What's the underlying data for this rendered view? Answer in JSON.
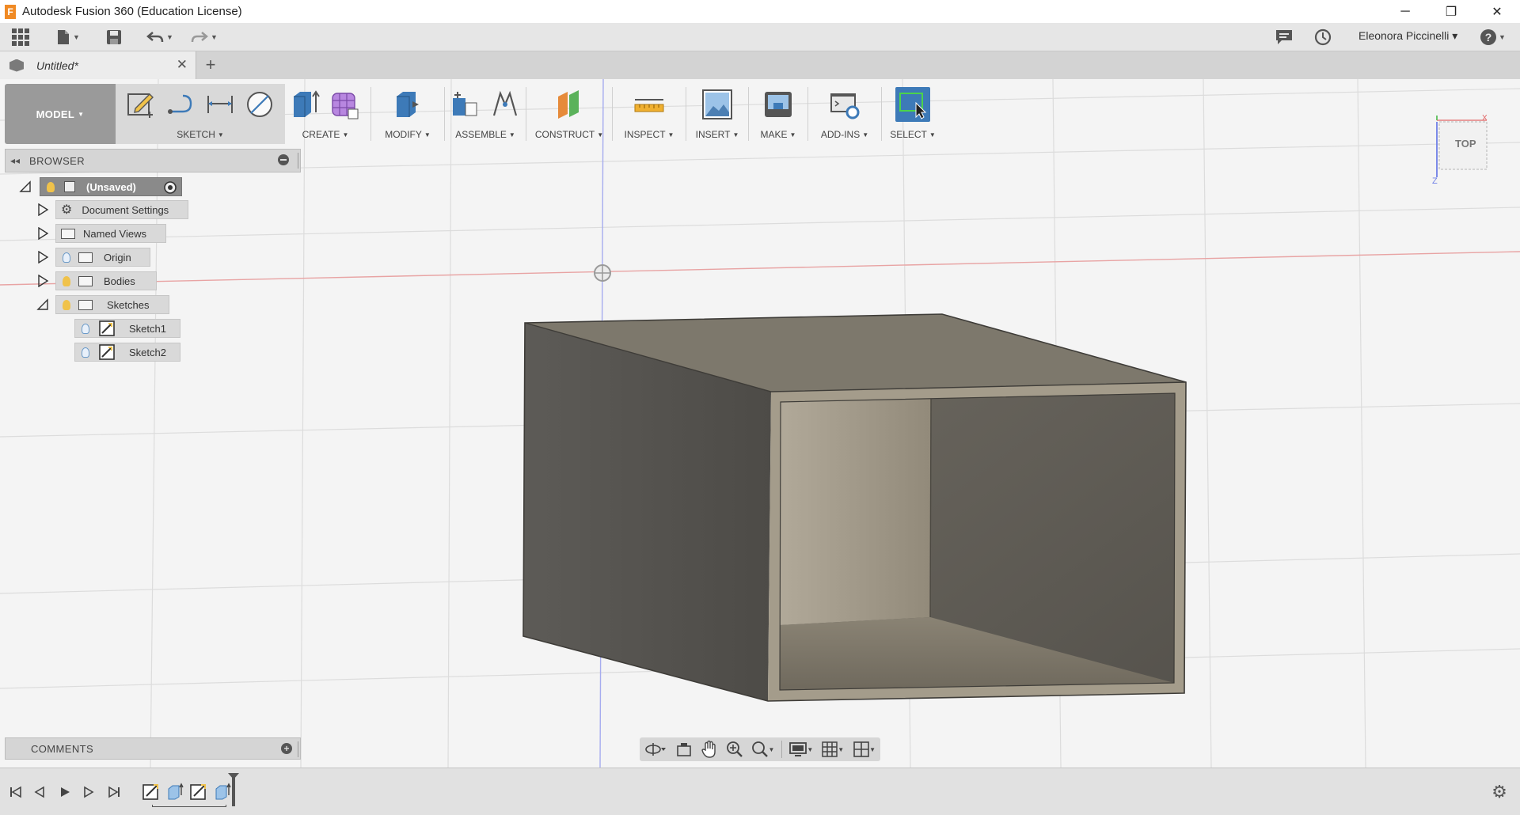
{
  "window": {
    "title": "Autodesk Fusion 360 (Education License)",
    "logo_letter": "F",
    "minimize": "─",
    "restore": "❐",
    "close": "✕"
  },
  "appbar": {
    "user_name": "Eleonora Piccinelli ▾",
    "help": "?"
  },
  "tabs": {
    "document": "Untitled*",
    "close": "✕",
    "new": "+"
  },
  "toolbar": {
    "workspace": "MODEL",
    "groups": {
      "sketch": "SKETCH",
      "create": "CREATE",
      "modify": "MODIFY",
      "assemble": "ASSEMBLE",
      "construct": "CONSTRUCT",
      "inspect": "INSPECT",
      "insert": "INSERT",
      "make": "MAKE",
      "addins": "ADD-INS",
      "select": "SELECT"
    }
  },
  "browser": {
    "title": "BROWSER",
    "root": "(Unsaved)",
    "items": {
      "document_settings": "Document Settings",
      "named_views": "Named Views",
      "origin": "Origin",
      "bodies": "Bodies",
      "sketches": "Sketches",
      "sketch1": "Sketch1",
      "sketch2": "Sketch2"
    }
  },
  "comments": {
    "title": "COMMENTS",
    "plus": "+"
  },
  "viewcube": {
    "face": "TOP"
  },
  "colors": {
    "accent": "#3d7ab8",
    "x_axis": "#e06666",
    "y_axis": "#6f7fe6",
    "body_dark": "#5f5c55",
    "body_top": "#807a6c",
    "body_light": "#a8a090"
  }
}
